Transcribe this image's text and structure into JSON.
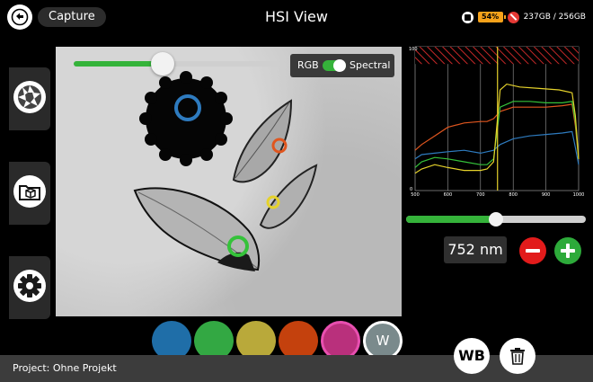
{
  "header": {
    "capture_label": "Capture",
    "title": "HSI View",
    "battery": "54%",
    "storage": "237GB / 256GB"
  },
  "sidebar": {
    "items": [
      {
        "name": "aperture-icon"
      },
      {
        "name": "folder-cube-icon"
      },
      {
        "name": "gear-icon"
      }
    ]
  },
  "image_view": {
    "brightness_level": 0.43,
    "mode": {
      "left_label": "RGB",
      "right_label": "Spectral",
      "spectral_on": true
    },
    "markers": [
      {
        "color": "#2e7bbf"
      },
      {
        "color": "#e0561f"
      },
      {
        "color": "#e5d22b"
      },
      {
        "color": "#35c23a"
      }
    ]
  },
  "chart_data": {
    "type": "line",
    "y_tick_labels": [
      "100",
      "0"
    ],
    "x_ticks": [
      500,
      600,
      700,
      800,
      900,
      1000
    ],
    "xlim": [
      500,
      1000
    ],
    "ylim": [
      0,
      100
    ],
    "grid": true,
    "cursor_x": 752,
    "saturation_band": [
      88,
      100
    ],
    "series": [
      {
        "color": "#2e7bbf",
        "x": [
          500,
          520,
          560,
          600,
          650,
          700,
          740,
          760,
          800,
          850,
          900,
          950,
          980,
          990,
          1000
        ],
        "y": [
          22,
          25,
          26,
          27,
          28,
          26,
          28,
          32,
          36,
          38,
          39,
          40,
          41,
          30,
          18
        ]
      },
      {
        "color": "#e0561f",
        "x": [
          500,
          520,
          560,
          600,
          650,
          700,
          720,
          740,
          760,
          800,
          850,
          900,
          950,
          980,
          990,
          1000
        ],
        "y": [
          28,
          32,
          38,
          44,
          47,
          48,
          48,
          50,
          55,
          58,
          58,
          58,
          59,
          60,
          45,
          22
        ]
      },
      {
        "color": "#35c23a",
        "x": [
          500,
          520,
          560,
          600,
          650,
          700,
          720,
          740,
          760,
          800,
          850,
          900,
          950,
          980,
          990,
          1000
        ],
        "y": [
          16,
          20,
          23,
          22,
          20,
          18,
          18,
          22,
          58,
          62,
          62,
          61,
          61,
          62,
          48,
          22
        ]
      },
      {
        "color": "#e5d22b",
        "x": [
          500,
          520,
          560,
          600,
          650,
          700,
          720,
          740,
          760,
          780,
          820,
          880,
          940,
          980,
          990,
          1000
        ],
        "y": [
          12,
          15,
          18,
          16,
          14,
          14,
          15,
          20,
          70,
          74,
          72,
          71,
          70,
          68,
          52,
          22
        ]
      }
    ]
  },
  "wavelength": {
    "value": "752 nm",
    "slider_level": 0.5
  },
  "swatches": [
    {
      "name": "swatch-blue",
      "color": "#1f6ea8"
    },
    {
      "name": "swatch-green",
      "color": "#33a843"
    },
    {
      "name": "swatch-yellow",
      "color": "#b9a93a"
    },
    {
      "name": "swatch-orange",
      "color": "#c4410d"
    },
    {
      "name": "swatch-magenta",
      "color": "#b9307c",
      "border": "#e84fb0"
    },
    {
      "name": "swatch-white",
      "color": "#7a8a8c",
      "label": "W"
    }
  ],
  "footer": {
    "project": "Project: Ohne Projekt",
    "wb_label": "WB"
  }
}
